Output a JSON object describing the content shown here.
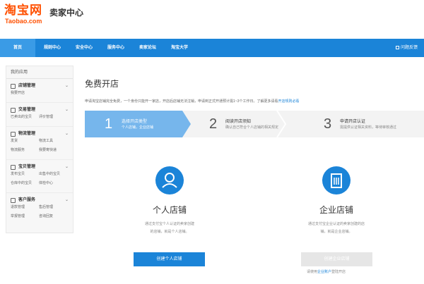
{
  "header": {
    "logo_cn": "淘宝网",
    "logo_en": "Taobao.com",
    "title": "卖家中心",
    "brand_color": "#ff5000"
  },
  "topnav": {
    "bg_color": "#1b84d8",
    "items": [
      "首页",
      "规则中心",
      "安全中心",
      "服务中心",
      "卖家论坛",
      "淘宝大学"
    ],
    "feedback": "问题反馈"
  },
  "sidebar": {
    "title": "我的应用",
    "groups": [
      {
        "label": "店铺管理",
        "icon": "store-icon",
        "links": [
          "我要开店"
        ]
      },
      {
        "label": "交易管理",
        "icon": "trade-icon",
        "links": [
          "已卖出的宝贝",
          "评价管理"
        ]
      },
      {
        "label": "物流管理",
        "icon": "logistics-icon",
        "links": [
          "发货",
          "物流工具",
          "物流服务",
          "我要寄快递"
        ]
      },
      {
        "label": "宝贝管理",
        "icon": "item-icon",
        "links": [
          "发布宝贝",
          "出售中的宝贝",
          "仓库中的宝贝",
          "体检中心"
        ]
      },
      {
        "label": "客户服务",
        "icon": "service-icon",
        "links": [
          "退款管理",
          "售后管理",
          "举报管理",
          "咨询回复"
        ]
      }
    ]
  },
  "main": {
    "title": "免费开店",
    "notice": "申请淘宝店铺完全免费，一个身份只能开一家店，开店后店铺无法注销，申请到正式开通预计需1~3个工作日。了解更多请看",
    "notice_link": "开店规则必看",
    "steps": [
      {
        "num": "1",
        "title": "选择开店类型",
        "sub": "个人店铺，企业店铺"
      },
      {
        "num": "2",
        "title": "阅读开店须知",
        "sub": "确认自己符合个人店铺的相关规定"
      },
      {
        "num": "3",
        "title": "申请开店认证",
        "sub": "需提供认证相关资料，等待审核通过"
      }
    ],
    "personal": {
      "title": "个人店铺",
      "desc1": "通过支付宝个人认证的卖家创建",
      "desc2": "的店铺，就是个人店铺。",
      "button": "创建个人店铺"
    },
    "enterprise": {
      "title": "企业店铺",
      "desc1": "通过支付宝企业认证的卖家创建的店",
      "desc2": "铺，就是企业店铺。",
      "button": "创建企业店铺",
      "note_pre": "请使用",
      "note_link": "企业账户",
      "note_post": "登陆开店"
    }
  }
}
